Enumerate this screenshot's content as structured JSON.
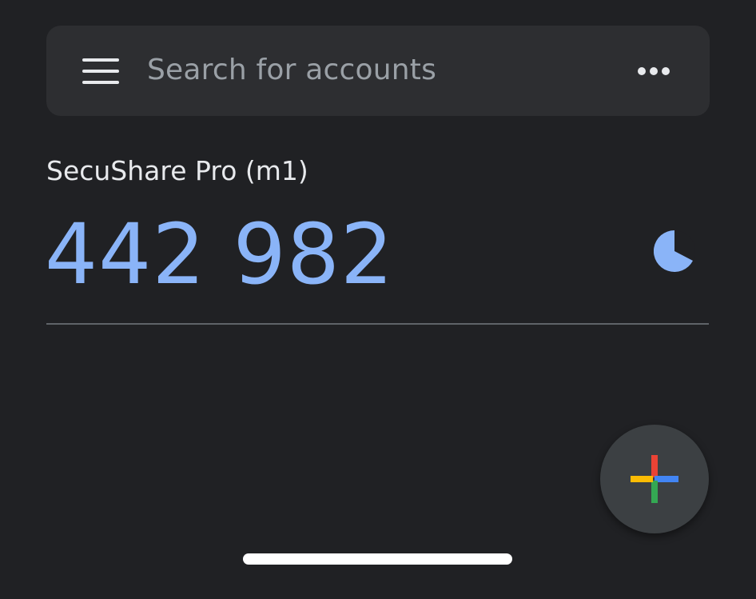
{
  "search": {
    "placeholder": "Search for accounts"
  },
  "account": {
    "name": "SecuShare Pro (m1)",
    "code": "442 982"
  },
  "icons": {
    "menu": "menu-icon",
    "more": "more-horizontal-icon",
    "timer": "countdown-timer-icon",
    "add": "add-plus-icon"
  },
  "colors": {
    "background": "#202124",
    "search_bar": "#2d2e31",
    "code_blue": "#8ab4f8",
    "plus_red": "#ea4335",
    "plus_blue": "#4285f4",
    "plus_green": "#34a853",
    "plus_yellow": "#fbbc04"
  }
}
